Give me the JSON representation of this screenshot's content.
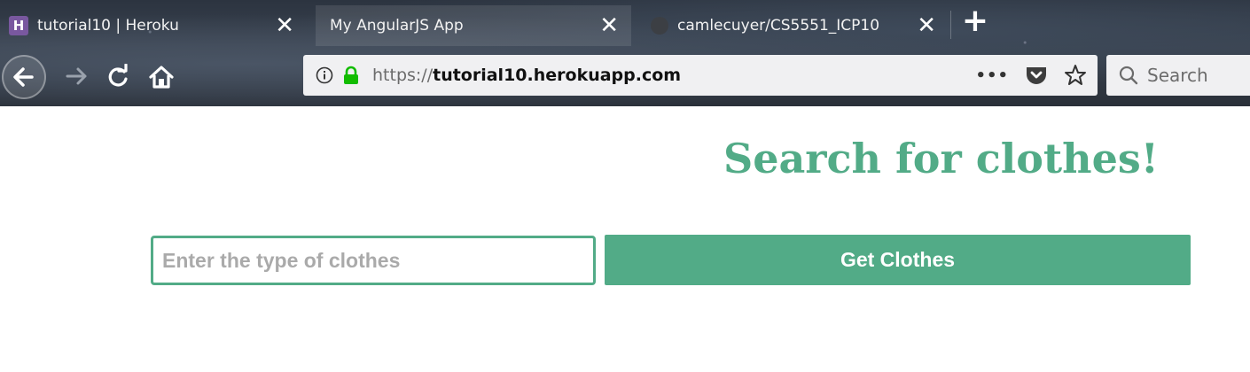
{
  "browser": {
    "tabs": [
      {
        "title": "tutorial10 | Heroku",
        "favicon": "heroku-icon",
        "active": false,
        "favicon_letter": "H"
      },
      {
        "title": "My AngularJS App",
        "favicon": "",
        "active": true
      },
      {
        "title": "camlecuyer/CS5551_ICP10",
        "favicon": "github-icon",
        "active": false
      }
    ],
    "close_glyph": "✕",
    "new_tab_glyph": "+",
    "url": {
      "protocol": "https://",
      "host": "tutorial10.herokuapp.com"
    },
    "page_actions_glyph": "•••",
    "search_placeholder": "Search"
  },
  "page": {
    "title": "Search for clothes!",
    "input_placeholder": "Enter the type of clothes",
    "input_value": "",
    "button_label": "Get Clothes"
  },
  "colors": {
    "accent": "#52ab87",
    "heroku": "#79589f"
  }
}
